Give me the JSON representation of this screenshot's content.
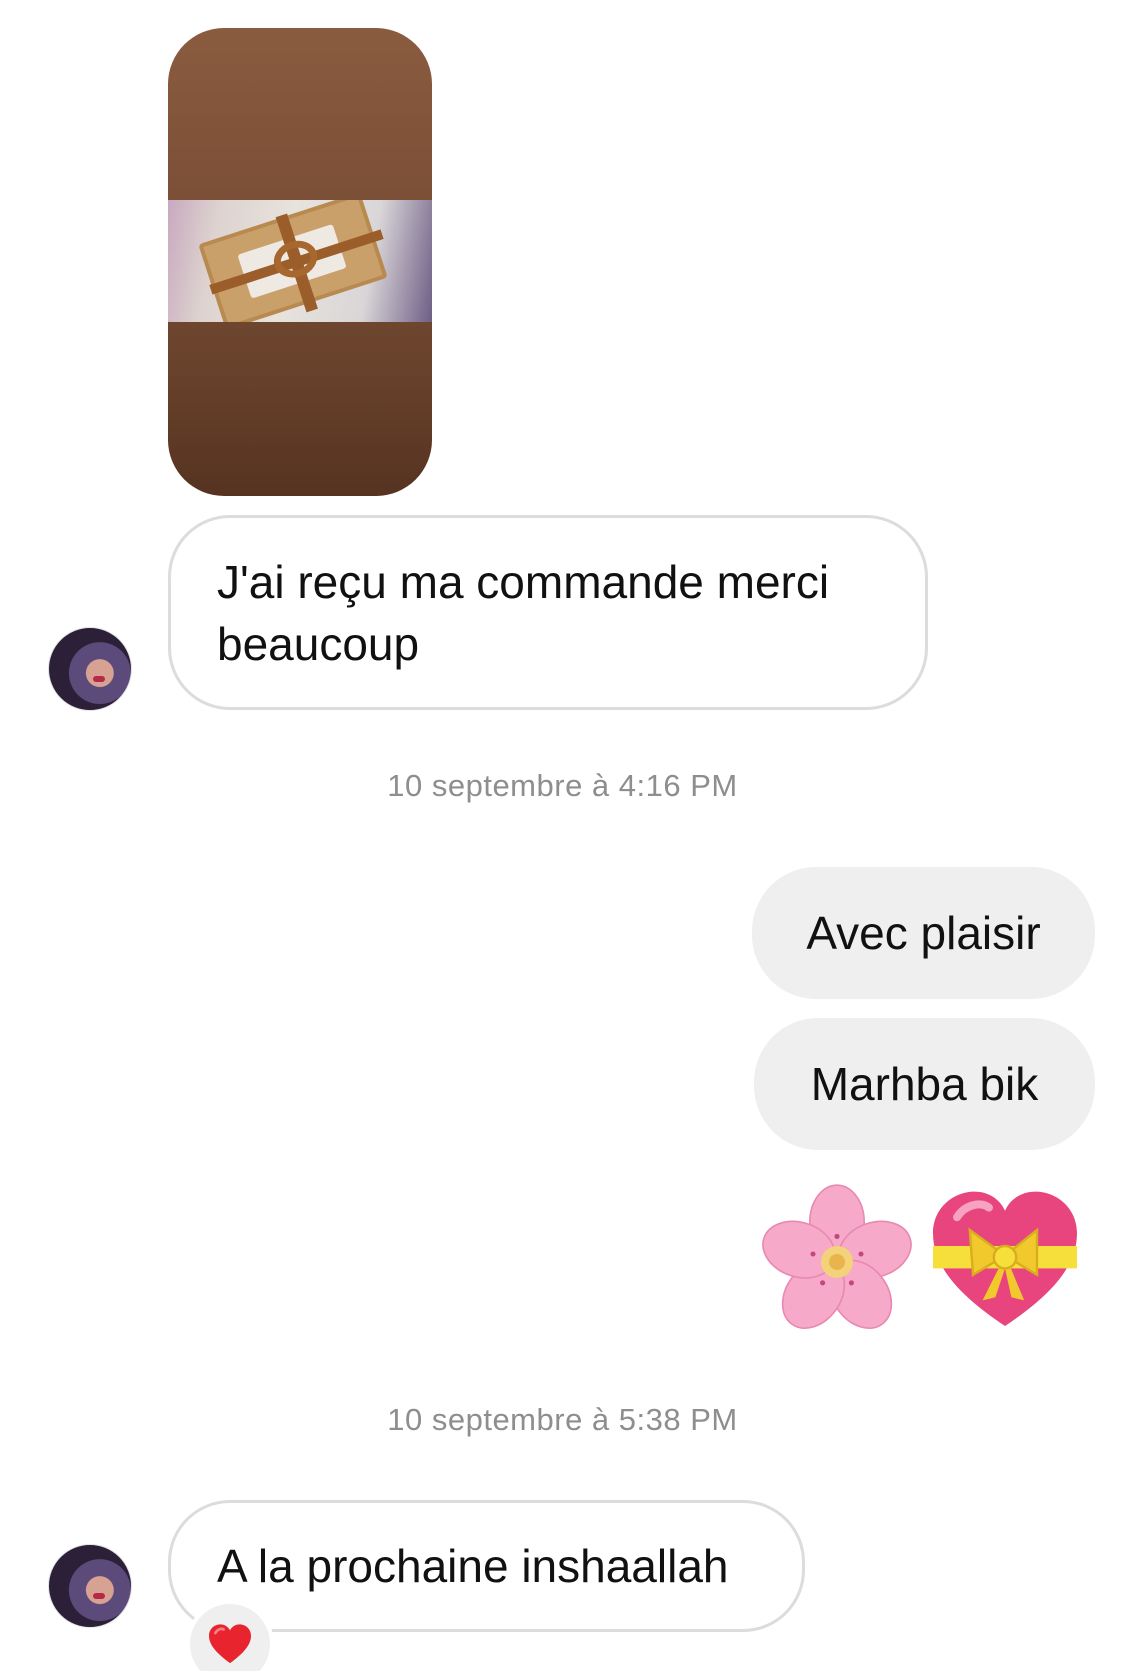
{
  "conversation": {
    "messages": [
      {
        "sender": "other",
        "type": "photo",
        "description_icon": "gift-box-photo"
      },
      {
        "sender": "other",
        "type": "text",
        "text": "J'ai reçu ma commande merci beaucoup"
      },
      {
        "type": "timestamp",
        "text": "10 septembre à 4:16 PM"
      },
      {
        "sender": "me",
        "type": "text",
        "text": "Avec plaisir"
      },
      {
        "sender": "me",
        "type": "text",
        "text": "Marhba bik"
      },
      {
        "sender": "me",
        "type": "emoji",
        "icons": [
          "cherry-blossom-icon",
          "heart-with-ribbon-icon"
        ]
      },
      {
        "type": "timestamp",
        "text": "10 septembre à 5:38 PM"
      },
      {
        "sender": "other",
        "type": "text",
        "text": "A la prochaine inshaallah",
        "reaction": "red-heart-icon"
      }
    ]
  },
  "colors": {
    "incoming_border": "#dcdcdc",
    "outgoing_bg": "#efefef",
    "timestamp": "#8e8e8e"
  }
}
